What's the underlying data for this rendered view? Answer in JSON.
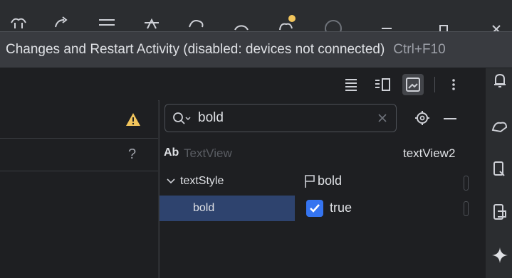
{
  "tooltip": {
    "text": "Changes and Restart Activity (disabled: devices not connected)",
    "shortcut": "Ctrl+F10"
  },
  "attributes": {
    "search": {
      "value": "bold"
    },
    "component": {
      "type_badge": "Ab",
      "type": "TextView",
      "id": "textView2"
    },
    "rows": [
      {
        "name": "textStyle",
        "value": "bold"
      },
      {
        "name": "bold",
        "value": "true",
        "checked": true
      }
    ]
  },
  "left_panel": {
    "help_label": "?"
  },
  "colors": {
    "accent": "#3574f0",
    "selection": "#2e436e",
    "warning": "#f2c55c"
  }
}
